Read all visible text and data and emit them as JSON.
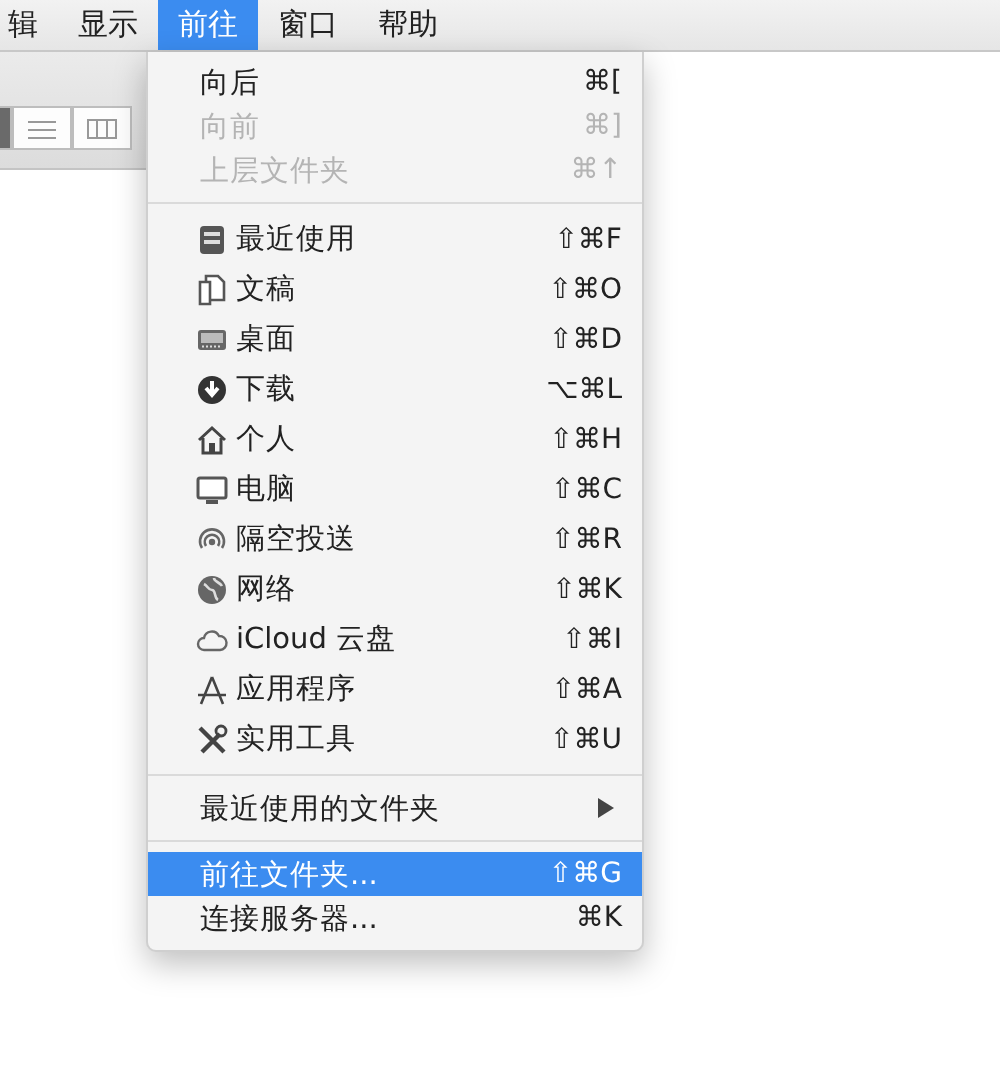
{
  "menubar": [
    {
      "label": "辑",
      "selected": false
    },
    {
      "label": "显示",
      "selected": false
    },
    {
      "label": "前往",
      "selected": true
    },
    {
      "label": "窗口",
      "selected": false
    },
    {
      "label": "帮助",
      "selected": false
    }
  ],
  "toolbar": {
    "view_buttons": [
      {
        "selected": true
      },
      {
        "selected": false
      },
      {
        "selected": false
      }
    ]
  },
  "menu": {
    "sections": [
      [
        {
          "kind": "plain",
          "label": "向后",
          "shortcut": "⌘[",
          "disabled": false,
          "selected": false
        },
        {
          "kind": "plain",
          "label": "向前",
          "shortcut": "⌘]",
          "disabled": true,
          "selected": false
        },
        {
          "kind": "plain",
          "label": "上层文件夹",
          "shortcut": "⌘↑",
          "disabled": true,
          "selected": false
        }
      ],
      [
        {
          "kind": "icon",
          "label": "最近使用",
          "shortcut": "⇧⌘F",
          "disabled": false,
          "selected": false
        },
        {
          "kind": "icon",
          "label": "文稿",
          "shortcut": "⇧⌘O",
          "disabled": false,
          "selected": false
        },
        {
          "kind": "icon",
          "label": "桌面",
          "shortcut": "⇧⌘D",
          "disabled": false,
          "selected": false
        },
        {
          "kind": "icon",
          "label": "下载",
          "shortcut": "⌥⌘L",
          "disabled": false,
          "selected": false
        },
        {
          "kind": "icon",
          "label": "个人",
          "shortcut": "⇧⌘H",
          "disabled": false,
          "selected": false
        },
        {
          "kind": "icon",
          "label": "电脑",
          "shortcut": "⇧⌘C",
          "disabled": false,
          "selected": false
        },
        {
          "kind": "icon",
          "label": "隔空投送",
          "shortcut": "⇧⌘R",
          "disabled": false,
          "selected": false
        },
        {
          "kind": "icon",
          "label": "网络",
          "shortcut": "⇧⌘K",
          "disabled": false,
          "selected": false
        },
        {
          "kind": "icon",
          "label": "iCloud 云盘",
          "shortcut": "⇧⌘I",
          "disabled": false,
          "selected": false
        },
        {
          "kind": "icon",
          "label": "应用程序",
          "shortcut": "⇧⌘A",
          "disabled": false,
          "selected": false
        },
        {
          "kind": "icon",
          "label": "实用工具",
          "shortcut": "⇧⌘U",
          "disabled": false,
          "selected": false
        }
      ],
      [
        {
          "kind": "submenu",
          "label": "最近使用的文件夹",
          "disabled": false,
          "selected": false
        }
      ],
      [
        {
          "kind": "plain",
          "label": "前往文件夹...",
          "shortcut": "⇧⌘G",
          "disabled": false,
          "selected": true
        },
        {
          "kind": "plain",
          "label": "连接服务器...",
          "shortcut": "⌘K",
          "disabled": false,
          "selected": false
        }
      ]
    ]
  }
}
